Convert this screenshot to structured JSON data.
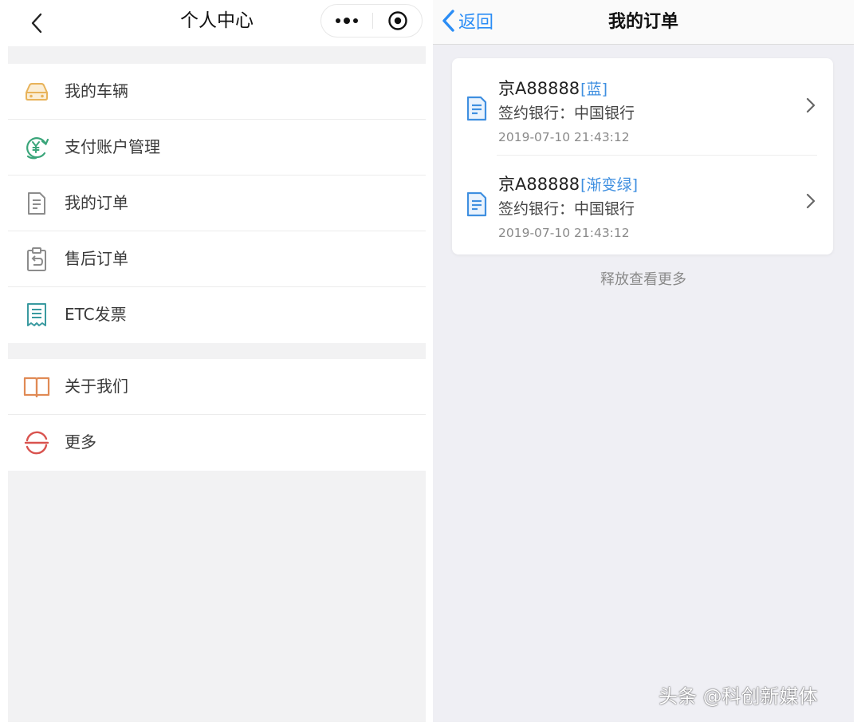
{
  "left_page": {
    "title": "个人中心",
    "group1": [
      {
        "label": "我的车辆",
        "icon": "car-icon"
      },
      {
        "label": "支付账户管理",
        "icon": "yuan-payment-icon"
      },
      {
        "label": "我的订单",
        "icon": "document-icon"
      },
      {
        "label": "售后订单",
        "icon": "clipboard-return-icon"
      },
      {
        "label": "ETC发票",
        "icon": "receipt-icon"
      }
    ],
    "group2": [
      {
        "label": "关于我们",
        "icon": "book-icon"
      },
      {
        "label": "更多",
        "icon": "refresh-icon"
      }
    ]
  },
  "right_page": {
    "back_label": "返回",
    "title": "我的订单",
    "orders": [
      {
        "plate": "京A88888",
        "plate_color": "[蓝]",
        "bank": "签约银行：中国银行",
        "time": "2019-07-10   21:43:12"
      },
      {
        "plate": "京A88888",
        "plate_color": "[渐变绿]",
        "bank": "签约银行：中国银行",
        "time": "2019-07-10   21:43:12"
      }
    ],
    "load_more": "释放查看更多"
  },
  "watermark": "头条 @科创新媒体",
  "colors": {
    "accent_blue": "#2b8df5",
    "plate_color_text": "#3f8fe0",
    "page_bg": "#f2f2f3",
    "icon_car": "#e8b35a",
    "icon_pay": "#3aa57a",
    "icon_book": "#e08a55",
    "icon_refresh": "#d9534f"
  }
}
